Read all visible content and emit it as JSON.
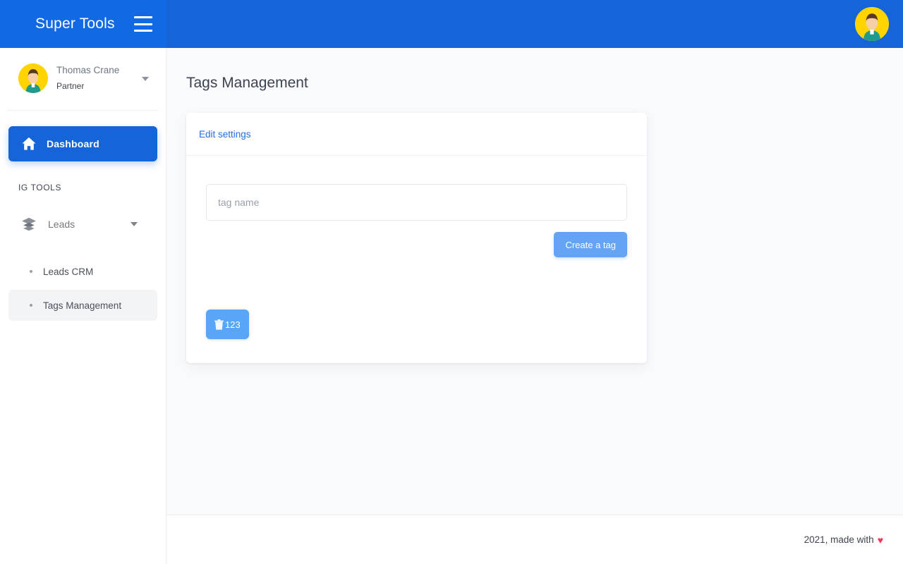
{
  "header": {
    "brand": "Super Tools",
    "menu_icon": "hamburger-icon",
    "avatar_icon": "user-avatar"
  },
  "sidebar": {
    "profile": {
      "name": "Thomas Crane",
      "role": "Partner",
      "caret_icon": "chevron-down-icon"
    },
    "nav": [
      {
        "label": "Dashboard",
        "icon": "home-icon",
        "active": true
      }
    ],
    "section_label": "IG TOOLS",
    "group": {
      "label": "Leads",
      "icon": "layers-icon",
      "caret_icon": "chevron-down-icon"
    },
    "sub_items": [
      {
        "label": "Leads CRM",
        "active": false
      },
      {
        "label": "Tags Management",
        "active": true
      }
    ]
  },
  "main": {
    "page_title": "Tags Management",
    "card": {
      "header_link": "Edit settings",
      "input": {
        "value": "",
        "placeholder": "tag name"
      },
      "create_button": "Create a tag",
      "tags": [
        {
          "label": "123",
          "icon": "trash-icon"
        }
      ]
    }
  },
  "footer": {
    "text": "2021, made with",
    "heart": "♥"
  },
  "colors": {
    "brand_blue": "#1565D8",
    "header_left_blue": "#1169E3",
    "link_blue": "#1f6fe5",
    "button_blue": "#63a4f4",
    "chip_blue": "#58a6f5",
    "avatar_yellow": "#FFD400",
    "heart_red": "#f4385a",
    "content_bg": "#f9fafc"
  }
}
